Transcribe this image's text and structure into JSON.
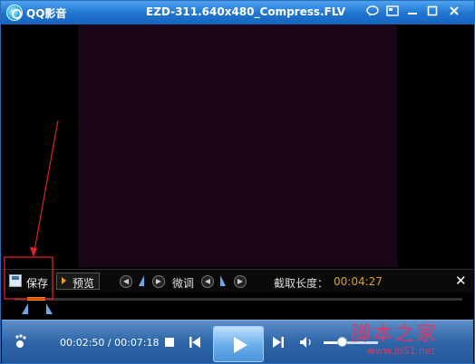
{
  "titlebar": {
    "app_name": "QQ影音",
    "file_title": "EZD-311.640x480_Compress.FLV",
    "icons": [
      "app-logo-icon",
      "chat-icon",
      "skin-icon",
      "minimize-icon",
      "close-icon"
    ]
  },
  "capture": {
    "save_label": "保存",
    "preview_label": "预览",
    "fine_tune_label": "微调",
    "length_label": "截取长度：",
    "length_value": "00:04:27"
  },
  "player": {
    "current_time": "00:02:50",
    "separator": " / ",
    "total_time": "00:07:18",
    "volume": 0.3
  },
  "watermark": {
    "text": "脚本之家",
    "url": "www.jb51.net"
  },
  "colors": {
    "accent_orange": "#e0a020",
    "title_blue": "#1f73cf",
    "annotation_red": "#e0202a"
  }
}
